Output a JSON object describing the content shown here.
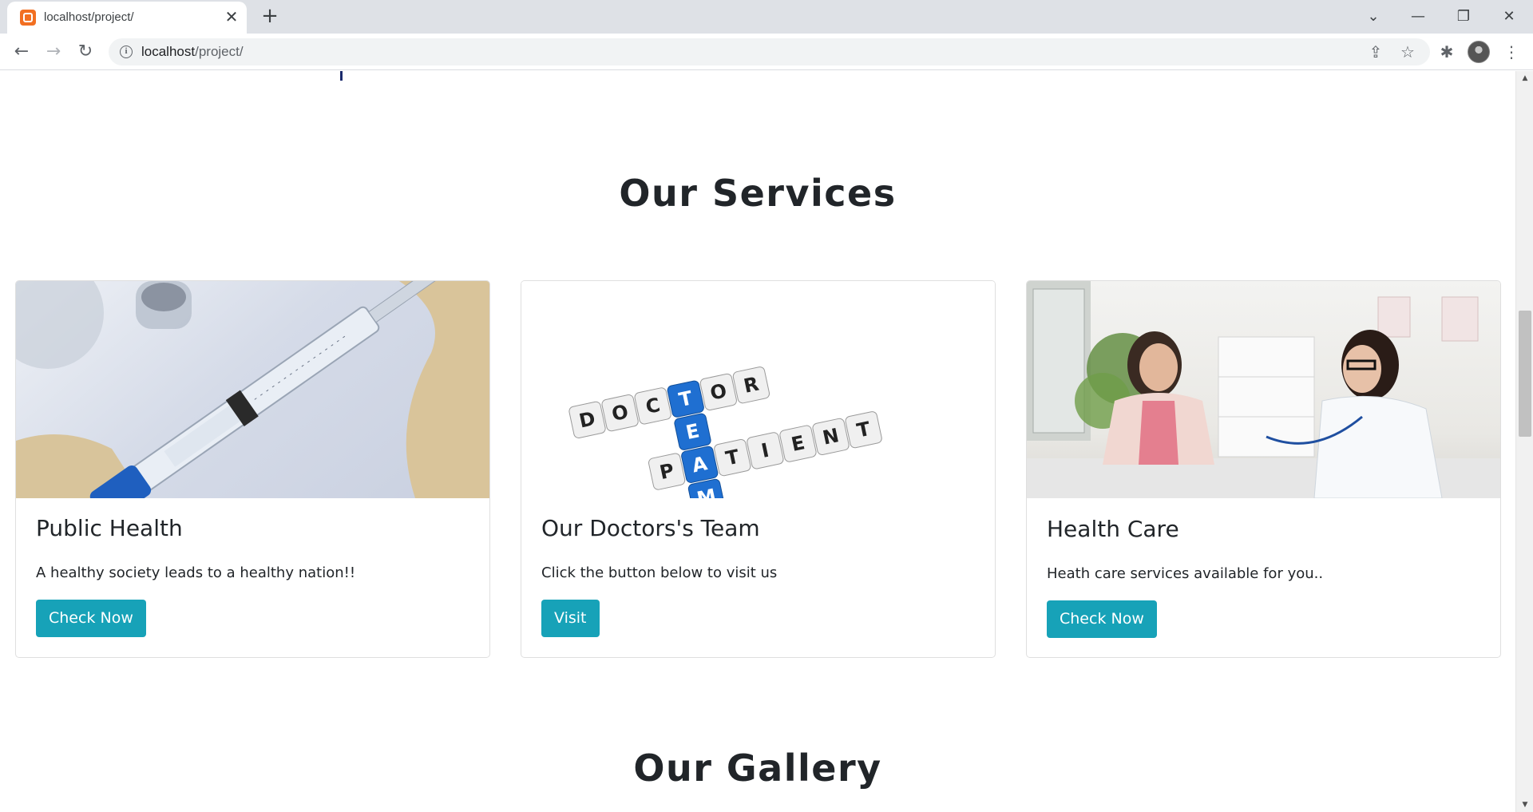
{
  "browser": {
    "tab_title": "localhost/project/",
    "url_host": "localhost",
    "url_path": "/project/"
  },
  "page": {
    "services_title": "Our Services",
    "gallery_title": "Our Gallery",
    "cards": [
      {
        "title": "Public Health",
        "text": "A healthy society leads to a healthy nation!!",
        "button": "Check Now"
      },
      {
        "title": "Our Doctors's Team",
        "text": "Click the button below to visit us",
        "button": "Visit",
        "image_words": [
          "DOCTOR",
          "PATIENT",
          "TEAM"
        ]
      },
      {
        "title": "Health Care",
        "text": "Heath care services available for you..",
        "button": "Check Now"
      }
    ]
  },
  "colors": {
    "button": "#17a2b8",
    "text": "#212529",
    "accent_blue": "#1f6fd1"
  }
}
